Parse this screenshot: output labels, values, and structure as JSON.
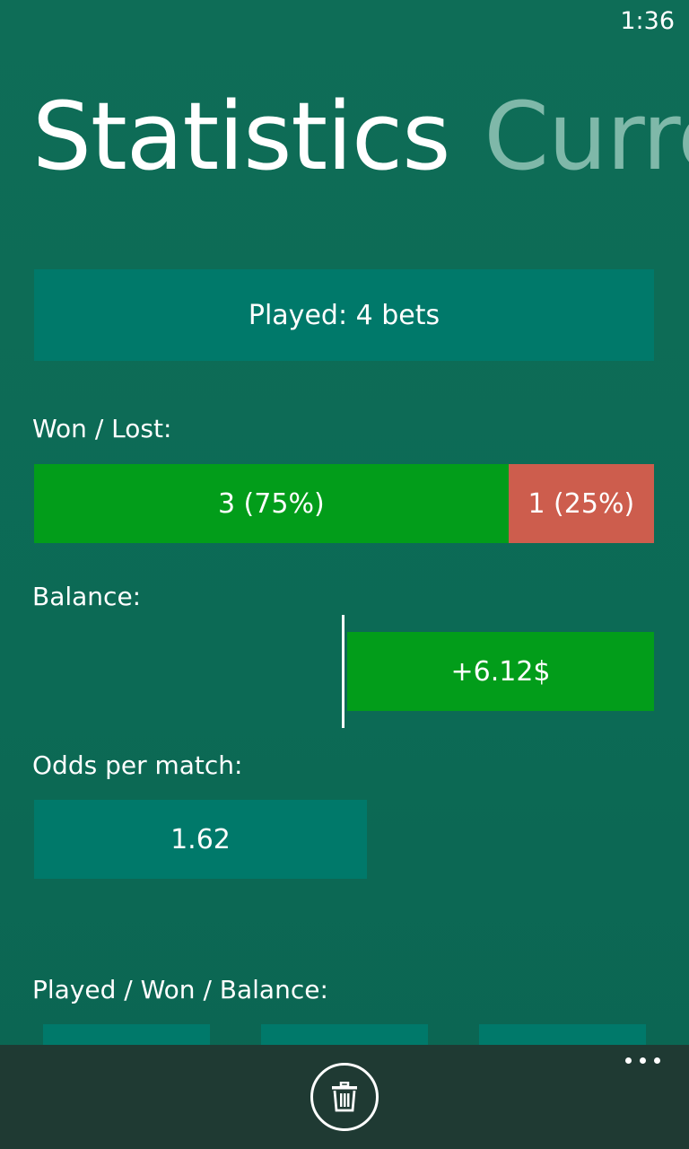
{
  "status_bar": {
    "time": "1:36"
  },
  "pivot": {
    "active_title": "Statistics",
    "next_title": "Curre"
  },
  "played": {
    "text": "Played: 4 bets"
  },
  "won_lost": {
    "label": "Won / Lost:",
    "won_text": "3 (75%)",
    "lost_text": "1 (25%)",
    "won_fraction": 0.765
  },
  "balance": {
    "label": "Balance:",
    "value_text": "+6.12$"
  },
  "odds": {
    "label": "Odds per match:",
    "value_text": "1.62"
  },
  "played_won_balance": {
    "label": "Played / Won / Balance:"
  },
  "app_bar": {
    "delete_icon": "trash-icon",
    "more_icon": "ellipsis-icon"
  },
  "colors": {
    "background": "#0e6b55",
    "tile": "#00796a",
    "won": "#029d1a",
    "lost": "#cd5d4d",
    "app_bar": "#1f3a33"
  }
}
